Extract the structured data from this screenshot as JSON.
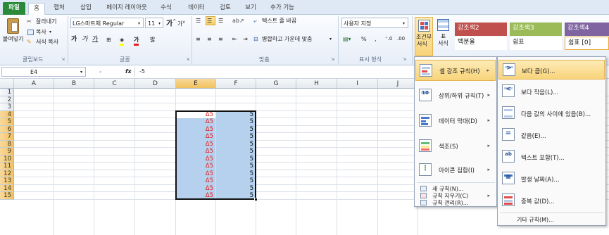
{
  "tabs": [
    "파일",
    "홈",
    "캡처",
    "삽입",
    "페이지 레이아웃",
    "수식",
    "데이터",
    "검토",
    "보기",
    "추가 기능"
  ],
  "clipboard": {
    "paste": "붙여넣기",
    "cut": "잘라내기",
    "copy": "복사",
    "format_painter": "서식 복사",
    "group_label": "클립보드"
  },
  "font": {
    "name": "LG스마트체 Regular",
    "size": "11",
    "group_label": "글꼴"
  },
  "alignment": {
    "wrap_text": "텍스트 줄 바꿈",
    "merge_center": "병합하고 가운데 맞춤",
    "group_label": "맞춤"
  },
  "number": {
    "format": "사용자 지정",
    "group_label": "표시 형식"
  },
  "styles": {
    "conditional_formatting": "조건부",
    "conditional_formatting_2": "서식",
    "format_table": "표",
    "format_table_2": "서식",
    "cells_row1": [
      {
        "label": "강조색2",
        "color": "#c0504d"
      },
      {
        "label": "강조색3",
        "color": "#9bbb59"
      },
      {
        "label": "강조색4",
        "color": "#8064a2"
      }
    ],
    "cells_row2": [
      {
        "label": "백분율"
      },
      {
        "label": "쉼표"
      },
      {
        "label": "쉼표 [0]"
      }
    ]
  },
  "formula_bar": {
    "name_box": "E4",
    "fx": "fx",
    "formula": "-5"
  },
  "grid": {
    "columns": [
      "A",
      "B",
      "C",
      "D",
      "E",
      "F",
      "G",
      "H",
      "I",
      "J"
    ],
    "rows": [
      "1",
      "2",
      "3",
      "4",
      "5",
      "6",
      "7",
      "8",
      "9",
      "10",
      "11",
      "12",
      "13",
      "14",
      "15"
    ],
    "e_values": [
      "Δ5",
      "Δ5",
      "Δ5",
      "Δ5",
      "Δ5",
      "Δ5",
      "Δ5",
      "Δ5",
      "Δ5",
      "Δ5",
      "Δ5",
      "Δ5"
    ],
    "f_values": [
      "5",
      "5",
      "5",
      "5",
      "5",
      "5",
      "5",
      "5",
      "5",
      "5",
      "5",
      "5"
    ]
  },
  "cf_menu": [
    {
      "label": "셀 강조 규칙(H)",
      "icon": "highlight-cells-icon",
      "submenu": true
    },
    {
      "label": "상위/하위 규칙(T)",
      "icon": "top-bottom-icon",
      "submenu": true
    },
    {
      "label": "데이터 막대(D)",
      "icon": "data-bars-icon",
      "submenu": true
    },
    {
      "label": "색조(S)",
      "icon": "color-scales-icon",
      "submenu": true
    },
    {
      "label": "아이콘 집합(I)",
      "icon": "icon-sets-icon",
      "submenu": true
    },
    {
      "label": "새 규칙(N)...",
      "icon": "new-rule-icon",
      "submenu": false
    },
    {
      "label": "규칙 지우기(C)",
      "icon": "clear-rules-icon",
      "submenu": true
    },
    {
      "label": "규칙 관리(R)...",
      "icon": "manage-rules-icon",
      "submenu": false
    }
  ],
  "highlight_submenu": [
    {
      "label": "보다 큼(G)...",
      "icon": "greater-than-icon"
    },
    {
      "label": "보다 작음(L)...",
      "icon": "less-than-icon"
    },
    {
      "label": "다음 값의 사이에 있음(B)...",
      "icon": "between-icon"
    },
    {
      "label": "같음(E)...",
      "icon": "equal-to-icon"
    },
    {
      "label": "텍스트 포함(T)...",
      "icon": "text-contains-icon"
    },
    {
      "label": "발생 날짜(A)...",
      "icon": "date-occurring-icon"
    },
    {
      "label": "중복 값(D)...",
      "icon": "duplicate-values-icon"
    }
  ],
  "more_rules": "기타 규칙(M)...",
  "colors": {
    "file_tab": "#2a8a3a",
    "selection": "#b5d1ee",
    "negative": "#e02020",
    "hover": "#f8d47a"
  }
}
